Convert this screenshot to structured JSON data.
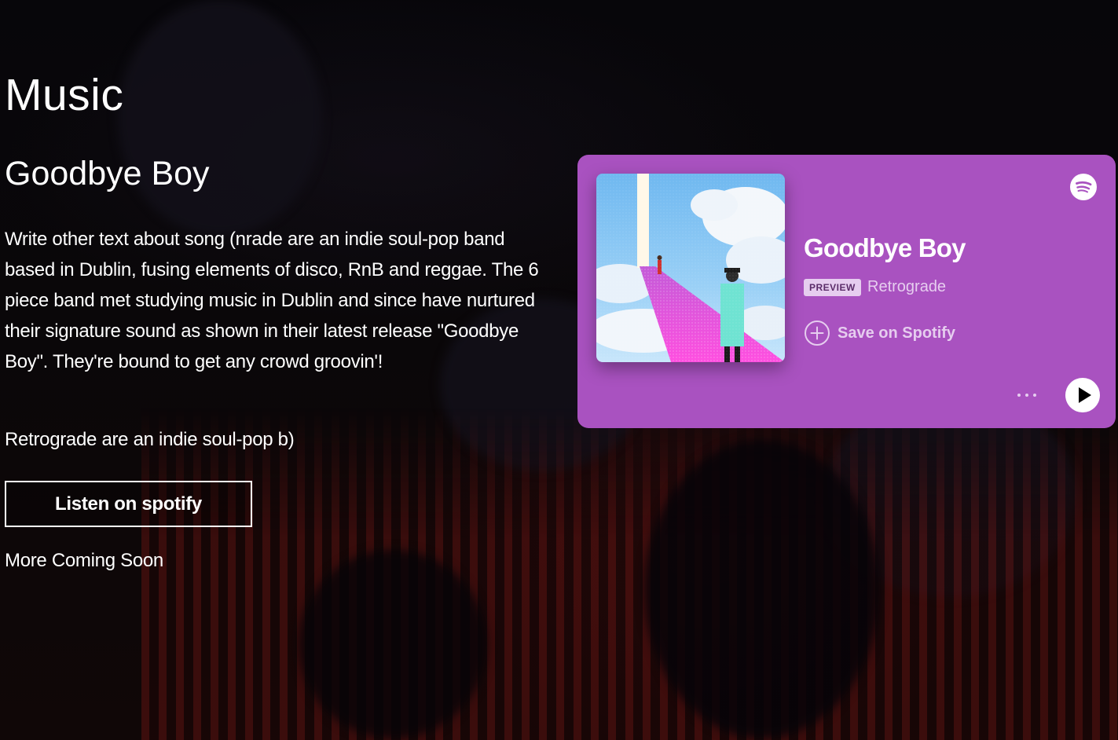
{
  "page": {
    "title": "Music"
  },
  "song": {
    "title": "Goodbye Boy",
    "description": "Write other text about song (nrade are an indie soul-pop band based in Dublin, fusing elements of disco, RnB and reggae. The 6 piece band met studying music in Dublin and since have nurtured their signature sound as shown in their latest release \"Goodbye Boy\". They're bound to get any crowd groovin'!",
    "short_text": "Retrograde are an indie soul-pop b)",
    "listen_button": "Listen on spotify",
    "more": "More Coming Soon"
  },
  "spotify_embed": {
    "track_title": "Goodbye Boy",
    "badge": "PREVIEW",
    "artist": "Retrograde",
    "save_label": "Save on Spotify",
    "colors": {
      "background": "#a952c0",
      "text": "#ffffff",
      "muted": "#e6cdef",
      "badge_bg": "#e6cdef",
      "badge_text": "#5b2c69"
    },
    "icons": {
      "brand": "spotify-logo-icon",
      "save": "plus-circle-icon",
      "more": "more-horizontal-icon",
      "play": "play-icon"
    }
  },
  "theme": {
    "page_bg": "#050407",
    "text": "#ffffff"
  }
}
